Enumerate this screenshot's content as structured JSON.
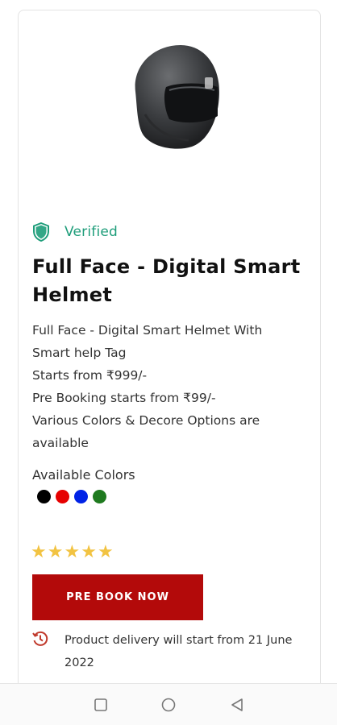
{
  "product": {
    "image_icon": "helmet-image",
    "verified_label": "Verified",
    "title": "Full Face - Digital Smart Helmet",
    "description_lines": [
      "Full Face - Digital Smart Helmet With Smart help Tag",
      "Starts from ₹999/-",
      "Pre Booking starts from ₹99/-",
      "Various Colors & Decore Options are available"
    ],
    "colors_label": "Available Colors",
    "colors": [
      "#000000",
      "#e60000",
      "#0022e6",
      "#1f7a1f"
    ],
    "rating": 5,
    "prebook_label": "PRE BOOK NOW",
    "delivery_text": "Product delivery will start from 21 June 2022"
  },
  "theme": {
    "accent": "#b30a0a",
    "verified_color": "#1e9d7a",
    "star_color": "#f2c342"
  },
  "navbar": {
    "icons": [
      "recents-icon",
      "home-icon",
      "back-icon"
    ]
  }
}
